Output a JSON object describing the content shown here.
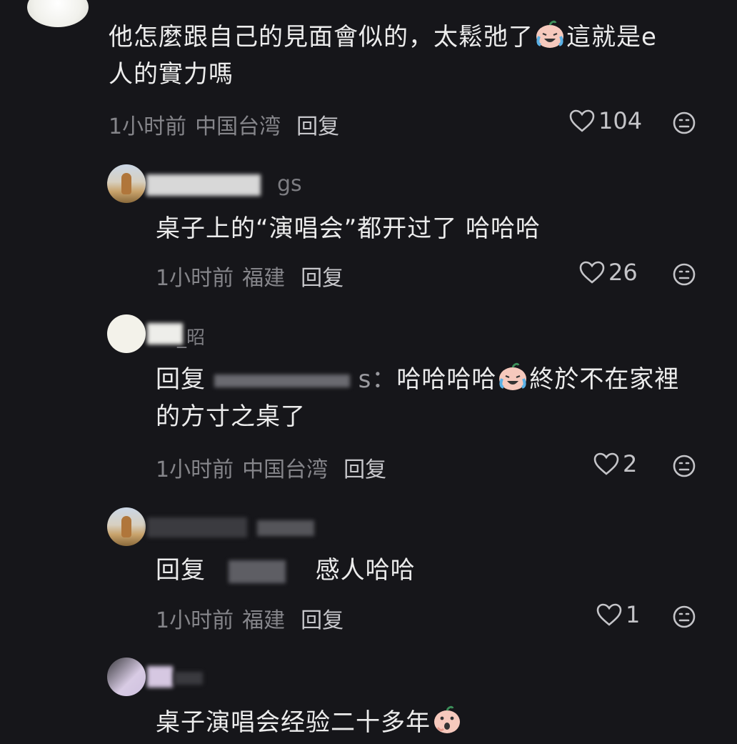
{
  "comments": [
    {
      "text_part1": "他怎麼跟自己的見面會似的，太鬆弛了",
      "text_part2": "這就是e",
      "text_line2": "人的實力嗎",
      "time": "1小时前",
      "location": "中国台湾",
      "reply_label": "回复",
      "likes": "104",
      "emoji": "crying-laughing-emoji"
    },
    {
      "username_fragment": "gs",
      "text": "桌子上的“演唱会”都开过了 哈哈哈",
      "time": "1小时前",
      "location": "福建",
      "reply_label": "回复",
      "likes": "26"
    },
    {
      "username_fragment": "_昭",
      "reply_prefix": "回复",
      "reply_target_fragment": "s：",
      "text_part1": "哈哈哈哈",
      "text_part2": "終於不在家裡",
      "text_line2": "的方寸之桌了",
      "time": "1小时前",
      "location": "中国台湾",
      "reply_label": "回复",
      "likes": "2",
      "emoji": "crying-laughing-emoji"
    },
    {
      "reply_prefix": "回复",
      "text": "感人哈哈",
      "time": "1小时前",
      "location": "福建",
      "reply_label": "回复",
      "likes": "1"
    },
    {
      "text": "桌子演唱会经验二十多年",
      "emoji": "shocked-face-emoji"
    }
  ],
  "icons": {
    "like": "heart-outline-icon",
    "dislike": "dislike-face-icon"
  },
  "colors": {
    "background": "#16161a",
    "text": "#ececec",
    "meta": "#85858a",
    "emoji_face": "#f6c9bd"
  }
}
